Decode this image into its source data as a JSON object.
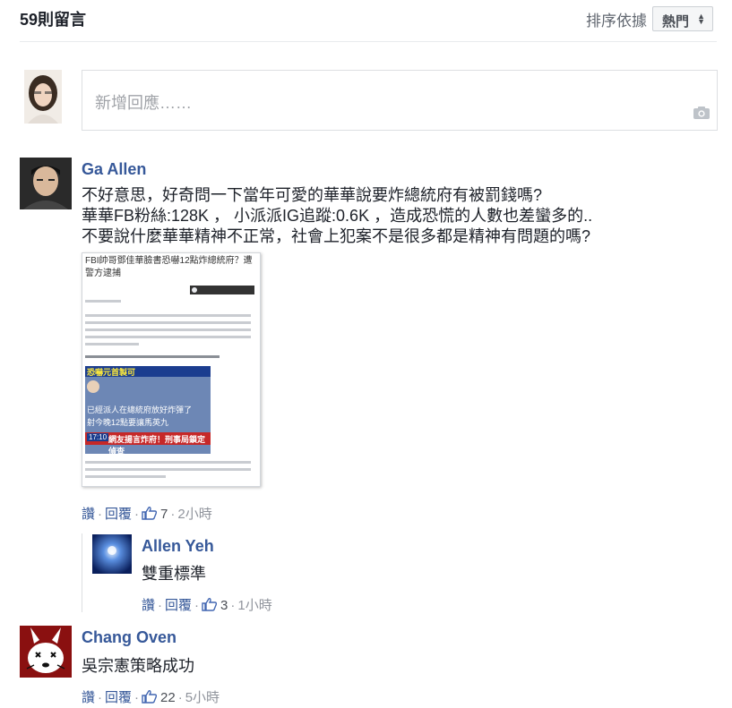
{
  "header": {
    "count_label": "59則留言",
    "sort_label": "排序依據",
    "sort_value": "熱門"
  },
  "composer": {
    "placeholder": "新增回應……"
  },
  "comments": [
    {
      "author": "Ga Allen",
      "lines": [
        "不好意思，好奇問一下當年可愛的華華說要炸總統府有被罰錢嗎?",
        "華華FB粉絲:128K ， 小派派IG追蹤:0.6K ，造成恐慌的人數也差蠻多的..",
        "不要說什麼華華精神不正常，社會上犯案不是很多都是精神有問題的嗎?"
      ],
      "image": {
        "headline": "FBI帥哥鄧佳華臉書恐嚇12點炸總統府？遭警方逮捕",
        "banner_top": "恐嚇元首製可",
        "banner_bottom": "網友揚言炸府！刑事局鎖定偵查",
        "chip": "17:10",
        "caption_line1": "已經派人在總統府放好炸彈了",
        "caption_line2": "射今晚12點要讓馬英九"
      },
      "actions": {
        "like": "讚",
        "reply": "回覆",
        "likes": "7",
        "time": "2小時"
      }
    },
    {
      "author": "Allen Yeh",
      "lines": [
        "雙重標準"
      ],
      "actions": {
        "like": "讚",
        "reply": "回覆",
        "likes": "3",
        "time": "1小時"
      }
    },
    {
      "author": "Chang Oven",
      "lines": [
        "吳宗憲策略成功"
      ],
      "actions": {
        "like": "讚",
        "reply": "回覆",
        "likes": "22",
        "time": "5小時"
      }
    }
  ],
  "icons": {
    "sort_caret": "sort-caret-icon",
    "camera": "camera-icon",
    "like": "thumbs-up-icon"
  },
  "colors": {
    "link": "#365899",
    "meta": "#90949c"
  }
}
